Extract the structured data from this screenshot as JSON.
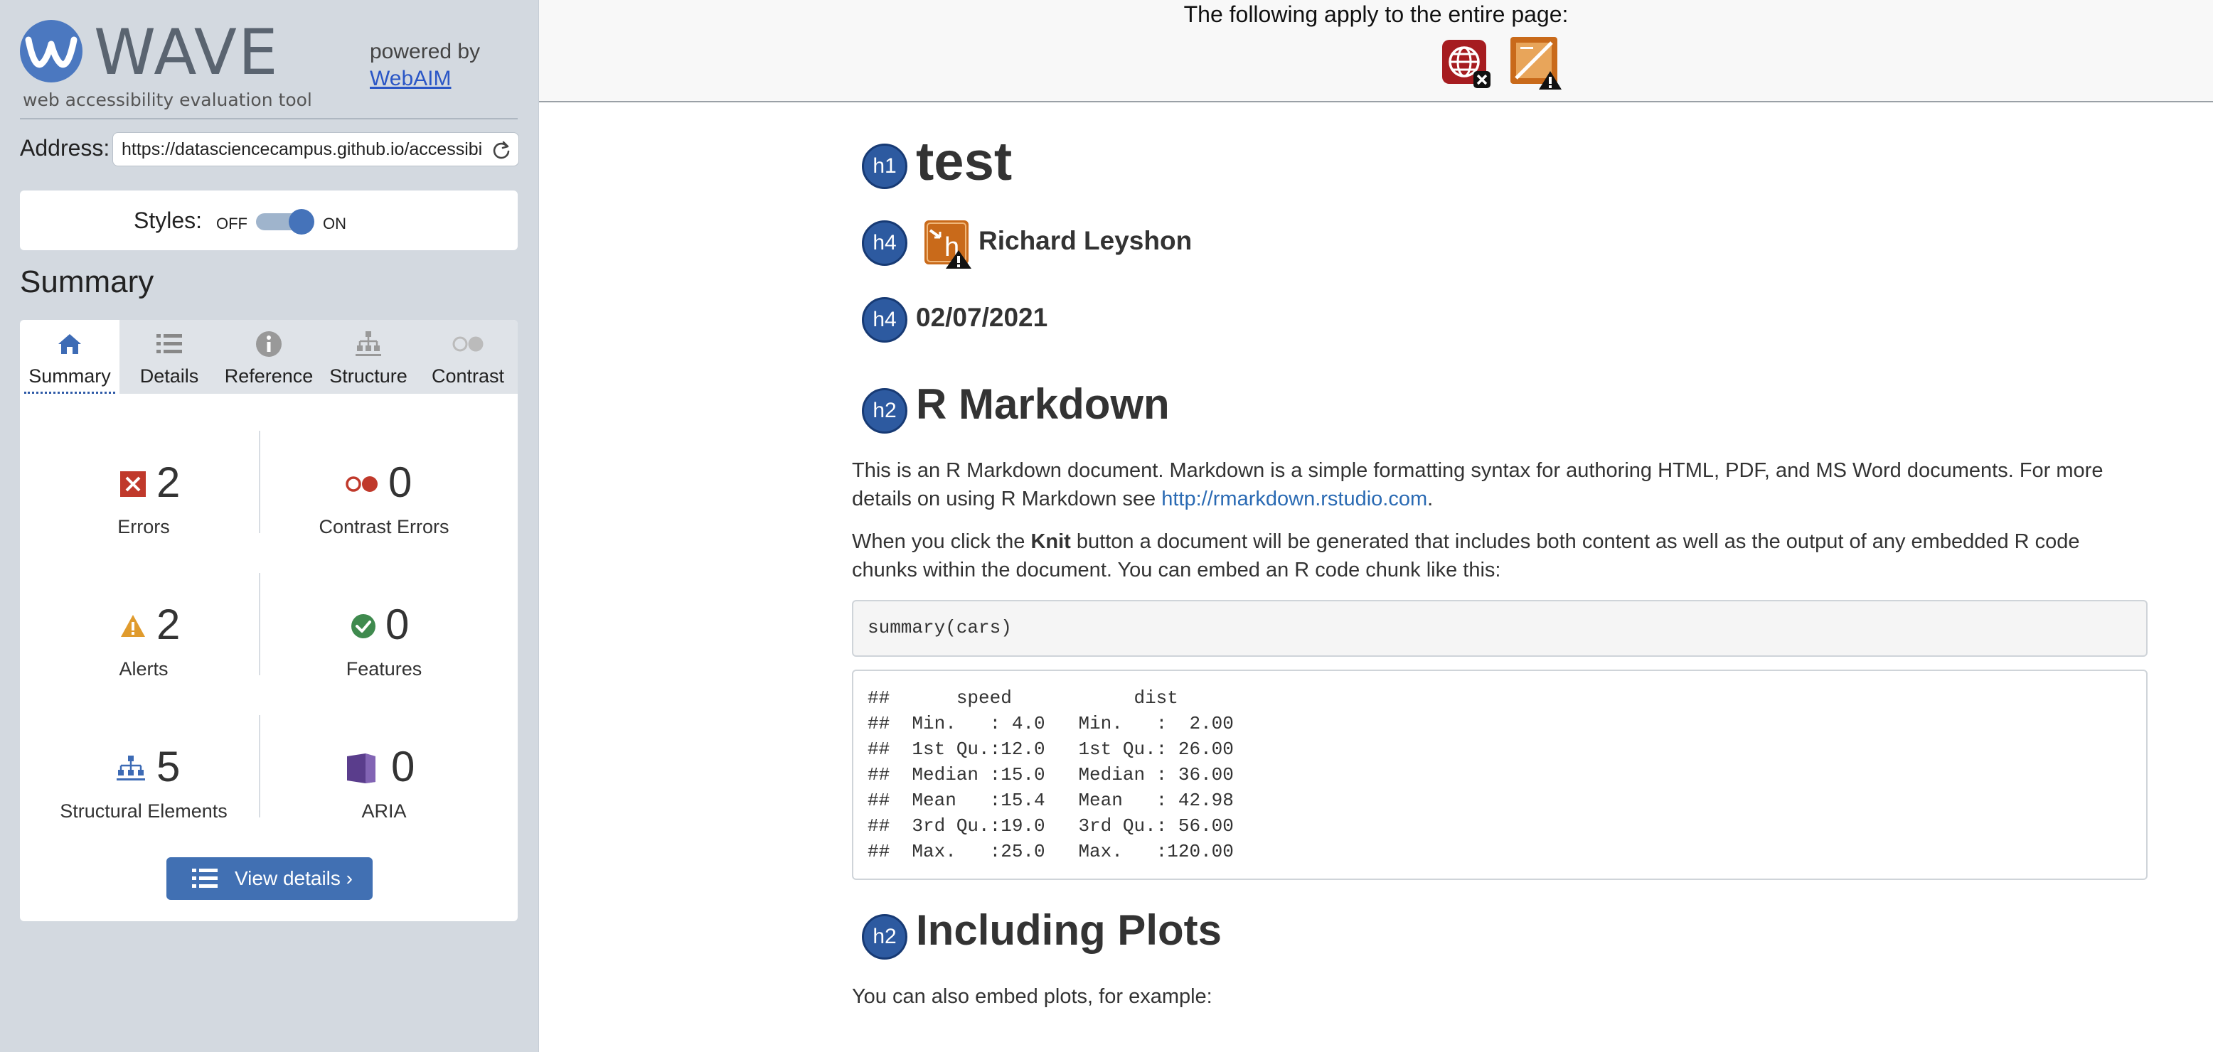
{
  "sidebar": {
    "logo_word": "WAVE",
    "logo_tagline": "web accessibility evaluation tool",
    "powered_by_text": "powered by",
    "powered_by_link": "WebAIM",
    "address_label": "Address:",
    "address_value": "https://datasciencecampus.github.io/accessibility",
    "styles_label": "Styles:",
    "styles_off": "OFF",
    "styles_on": "ON",
    "styles_state": "on",
    "summary_heading": "Summary",
    "tabs": [
      {
        "label": "Summary",
        "icon": "home-icon",
        "active": true
      },
      {
        "label": "Details",
        "icon": "list-icon",
        "active": false
      },
      {
        "label": "Reference",
        "icon": "info-icon",
        "active": false
      },
      {
        "label": "Structure",
        "icon": "structure-icon",
        "active": false
      },
      {
        "label": "Contrast",
        "icon": "contrast-icon",
        "active": false
      }
    ],
    "stats": {
      "errors": {
        "count": "2",
        "label": "Errors",
        "icon": "error-icon",
        "color": "#c0392b"
      },
      "contrast_errors": {
        "count": "0",
        "label": "Contrast Errors",
        "icon": "contrast-error-icon",
        "color": "#c0392b"
      },
      "alerts": {
        "count": "2",
        "label": "Alerts",
        "icon": "alert-icon",
        "color": "#e09b2d"
      },
      "features": {
        "count": "0",
        "label": "Features",
        "icon": "feature-icon",
        "color": "#3f8a4e"
      },
      "structural": {
        "count": "5",
        "label": "Structural Elements",
        "icon": "structure-icon",
        "color": "#3d6bb5"
      },
      "aria": {
        "count": "0",
        "label": "ARIA",
        "icon": "aria-icon",
        "color": "#5a3d8c"
      }
    },
    "view_details_label": "View details ›"
  },
  "top_bar": {
    "text": "The following apply to the entire page:",
    "icons": [
      "language-missing-error-icon",
      "contrast-alert-icon"
    ]
  },
  "document": {
    "h1": {
      "badge": "h1",
      "text": "test"
    },
    "author": {
      "badge": "h4",
      "text": "Richard Leyshon",
      "icon": "possible-heading-alert-icon"
    },
    "date": {
      "badge": "h4",
      "text": "02/07/2021"
    },
    "h2_markdown": {
      "badge": "h2",
      "text": "R Markdown"
    },
    "para1_text": "This is an R Markdown document. Markdown is a simple formatting syntax for authoring HTML, PDF, and MS Word documents. For more details on using R Markdown see ",
    "para1_link": "http://rmarkdown.rstudio.com",
    "para1_end": ".",
    "para2_before": "When you click the ",
    "para2_bold": "Knit",
    "para2_after": " button a document will be generated that includes both content as well as the output of any embedded R code chunks within the document. You can embed an R code chunk like this:",
    "code_input": "summary(cars)",
    "code_output": "##      speed           dist       \n##  Min.   : 4.0   Min.   :  2.00  \n##  1st Qu.:12.0   1st Qu.: 26.00  \n##  Median :15.0   Median : 36.00  \n##  Mean   :15.4   Mean   : 42.98  \n##  3rd Qu.:19.0   3rd Qu.: 56.00  \n##  Max.   :25.0   Max.   :120.00  ",
    "h2_plots": {
      "badge": "h2",
      "text": "Including Plots"
    },
    "para3": "You can also embed plots, for example:"
  }
}
